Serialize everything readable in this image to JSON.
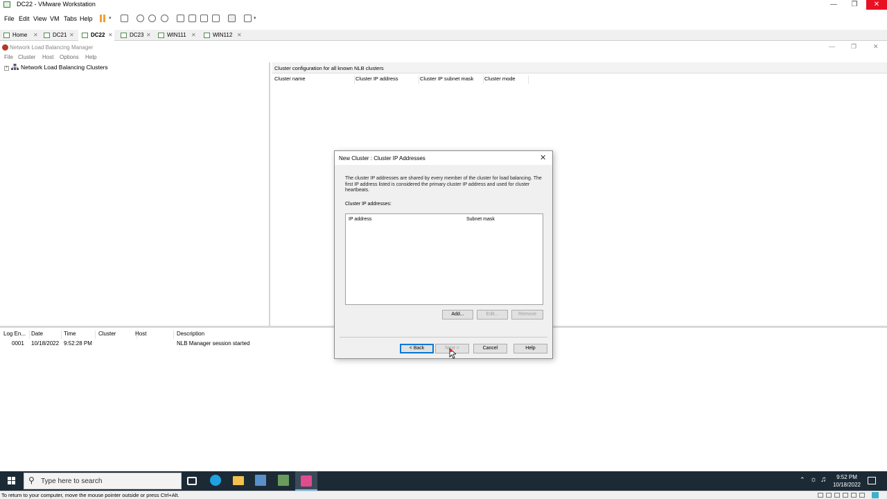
{
  "vmware": {
    "title": "DC22 - VMware Workstation",
    "menu": [
      "File",
      "Edit",
      "View",
      "VM",
      "Tabs",
      "Help"
    ],
    "tabs": [
      {
        "label": "Home"
      },
      {
        "label": "DC21"
      },
      {
        "label": "DC22"
      },
      {
        "label": "DC23"
      },
      {
        "label": "WIN111"
      },
      {
        "label": "WIN112"
      }
    ],
    "status_text": "To return to your computer, move the mouse pointer outside or press Ctrl+Alt."
  },
  "nlb": {
    "title": "Network Load Balancing Manager",
    "menu": [
      "File",
      "Cluster",
      "Host",
      "Options",
      "Help"
    ],
    "tree_root": "Network Load Balancing Clusters",
    "right_header": "Cluster configuration for all known NLB clusters",
    "columns": [
      "Cluster name",
      "Cluster IP address",
      "Cluster IP subnet mask",
      "Cluster mode"
    ],
    "log_columns": [
      "Log En...",
      "Date",
      "Time",
      "Cluster",
      "Host",
      "Description"
    ],
    "log_rows": [
      {
        "entry": "0001",
        "date": "10/18/2022",
        "time": "9:52:28 PM",
        "cluster": "",
        "host": "",
        "description": "NLB Manager session started"
      }
    ]
  },
  "dialog": {
    "title": "New Cluster :  Cluster IP Addresses",
    "description": "The cluster IP addresses are shared by every member of the cluster for load balancing. The first IP address listed is considered the primary cluster IP address and used for cluster heartbeats.",
    "ip_label": "Cluster IP addresses:",
    "list_columns": [
      "IP address",
      "Subnet mask"
    ],
    "buttons": {
      "add": "Add...",
      "edit": "Edit...",
      "remove": "Remove",
      "back": "< Back",
      "next": "Next >",
      "cancel": "Cancel",
      "help": "Help"
    }
  },
  "taskbar": {
    "search_placeholder": "Type here to search",
    "time": "9:52 PM",
    "date": "10/18/2022"
  },
  "colors": {
    "taskbar": "#1c2a36",
    "close_red": "#e81123",
    "accent_blue": "#0078d7",
    "pause_orange": "#f0a030"
  }
}
